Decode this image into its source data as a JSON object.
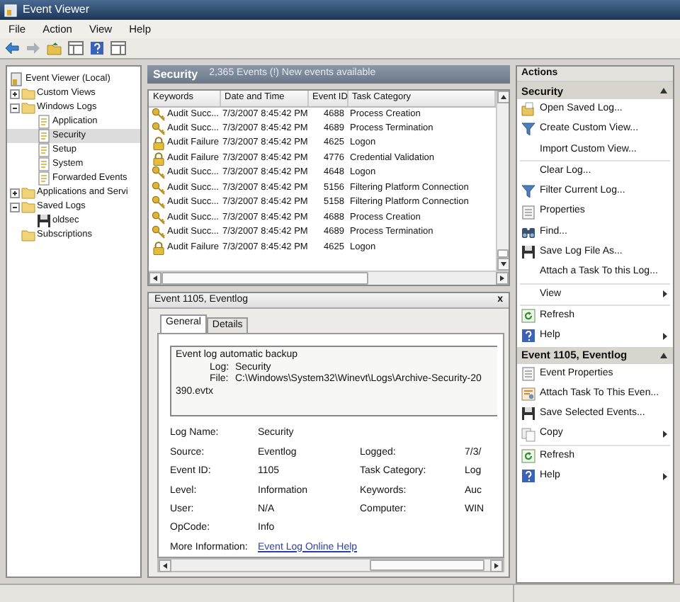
{
  "window": {
    "title": "Event Viewer"
  },
  "menu": [
    "File",
    "Action",
    "View",
    "Help"
  ],
  "tree": [
    {
      "label": "Event Viewer (Local)",
      "kind": "root",
      "selected": false,
      "children": [
        {
          "label": "Custom Views",
          "kind": "folder",
          "expanded": false,
          "selected": false
        },
        {
          "label": "Windows Logs",
          "kind": "folder",
          "expanded": true,
          "selected": false,
          "children": [
            {
              "label": "Application",
              "kind": "log",
              "selected": false
            },
            {
              "label": "Security",
              "kind": "log",
              "selected": true
            },
            {
              "label": "Setup",
              "kind": "log",
              "selected": false
            },
            {
              "label": "System",
              "kind": "log",
              "selected": false
            },
            {
              "label": "Forwarded Events",
              "kind": "log",
              "selected": false
            }
          ]
        },
        {
          "label": "Applications and Servi",
          "kind": "folder",
          "expanded": false,
          "selected": false
        },
        {
          "label": "Saved Logs",
          "kind": "folder",
          "expanded": true,
          "selected": false,
          "children": [
            {
              "label": "oldsec",
              "kind": "disk",
              "selected": false
            }
          ]
        },
        {
          "label": "Subscriptions",
          "kind": "folder",
          "selected": false
        }
      ]
    }
  ],
  "log": {
    "title": "Security",
    "summary": "2,365 Events (!) New events available",
    "columns": [
      "Keywords",
      "Date and Time",
      "Event ID",
      "Task Category"
    ],
    "rows": [
      {
        "kind": "success",
        "keywords": "Audit Succ...",
        "date": "7/3/2007 8:45:42 PM",
        "event_id": "4688",
        "task_category": "Process Creation"
      },
      {
        "kind": "success",
        "keywords": "Audit Succ...",
        "date": "7/3/2007 8:45:42 PM",
        "event_id": "4689",
        "task_category": "Process Termination"
      },
      {
        "kind": "failure",
        "keywords": "Audit Failure",
        "date": "7/3/2007 8:45:42 PM",
        "event_id": "4625",
        "task_category": "Logon"
      },
      {
        "kind": "failure",
        "keywords": "Audit Failure",
        "date": "7/3/2007 8:45:42 PM",
        "event_id": "4776",
        "task_category": "Credential Validation"
      },
      {
        "kind": "success",
        "keywords": "Audit Succ...",
        "date": "7/3/2007 8:45:42 PM",
        "event_id": "4648",
        "task_category": "Logon"
      },
      {
        "kind": "success",
        "keywords": "Audit Succ...",
        "date": "7/3/2007 8:45:42 PM",
        "event_id": "5156",
        "task_category": "Filtering Platform Connection"
      },
      {
        "kind": "success",
        "keywords": "Audit Succ...",
        "date": "7/3/2007 8:45:42 PM",
        "event_id": "5158",
        "task_category": "Filtering Platform Connection"
      },
      {
        "kind": "success",
        "keywords": "Audit Succ...",
        "date": "7/3/2007 8:45:42 PM",
        "event_id": "4688",
        "task_category": "Process Creation"
      },
      {
        "kind": "success",
        "keywords": "Audit Succ...",
        "date": "7/3/2007 8:45:42 PM",
        "event_id": "4689",
        "task_category": "Process Termination"
      },
      {
        "kind": "failure",
        "keywords": "Audit Failure",
        "date": "7/3/2007 8:45:42 PM",
        "event_id": "4625",
        "task_category": "Logon"
      }
    ]
  },
  "detail": {
    "title": "Event 1105, Eventlog",
    "close": "x",
    "tabs": [
      {
        "label": "General",
        "selected": true
      },
      {
        "label": "Details",
        "selected": false
      }
    ],
    "description": {
      "heading": "Event log automatic backup",
      "fields": [
        {
          "label": "Log:",
          "value": "Security"
        },
        {
          "label": "File:",
          "value": "C:\\Windows\\System32\\Winevt\\Logs\\Archive-Security-20"
        }
      ],
      "continuation": "390.evtx"
    },
    "properties": [
      {
        "label": "Log Name:",
        "value": "Security"
      },
      {
        "label": "Source:",
        "value": "Eventlog",
        "right_label": "Logged:",
        "right_value": "7/3/"
      },
      {
        "label": "Event ID:",
        "value": "1105",
        "right_label": "Task Category:",
        "right_value": "Log"
      },
      {
        "label": "Level:",
        "value": "Information",
        "right_label": "Keywords:",
        "right_value": "Auc"
      },
      {
        "label": "User:",
        "value": "N/A",
        "right_label": "Computer:",
        "right_value": "WIN"
      },
      {
        "label": "OpCode:",
        "value": "Info"
      },
      {
        "label": "More Information:",
        "link": "Event Log Online Help"
      }
    ]
  },
  "actions": {
    "title": "Actions",
    "sections": [
      {
        "title": "Security",
        "expanded": true,
        "groups": [
          [
            {
              "label": "Open Saved Log...",
              "kind": "open",
              "submenu": false
            },
            {
              "label": "Create Custom View...",
              "kind": "filter",
              "submenu": false
            },
            {
              "label": "Import Custom View...",
              "kind": "plain",
              "submenu": false
            }
          ],
          [
            {
              "label": "Clear Log...",
              "kind": "plain",
              "submenu": false
            },
            {
              "label": "Filter Current Log...",
              "kind": "filter",
              "submenu": false
            },
            {
              "label": "Properties",
              "kind": "properties",
              "submenu": false
            },
            {
              "label": "Find...",
              "kind": "find",
              "submenu": false
            },
            {
              "label": "Save Log File As...",
              "kind": "save",
              "submenu": false
            },
            {
              "label": "Attach a Task To this Log...",
              "kind": "plain",
              "submenu": false
            }
          ],
          [
            {
              "label": "View",
              "kind": "plain",
              "submenu": true
            }
          ],
          [
            {
              "label": "Refresh",
              "kind": "refresh",
              "submenu": false
            },
            {
              "label": "Help",
              "kind": "help",
              "submenu": true
            }
          ]
        ]
      },
      {
        "title": "Event 1105, Eventlog",
        "expanded": true,
        "groups": [
          [
            {
              "label": "Event Properties",
              "kind": "properties",
              "submenu": false
            },
            {
              "label": "Attach Task To This Even...",
              "kind": "task",
              "submenu": false
            },
            {
              "label": "Save Selected Events...",
              "kind": "save",
              "submenu": false
            },
            {
              "label": "Copy",
              "kind": "copy",
              "submenu": true
            }
          ],
          [
            {
              "label": "Refresh",
              "kind": "refresh",
              "submenu": false
            },
            {
              "label": "Help",
              "kind": "help",
              "submenu": true
            }
          ]
        ]
      }
    ]
  }
}
